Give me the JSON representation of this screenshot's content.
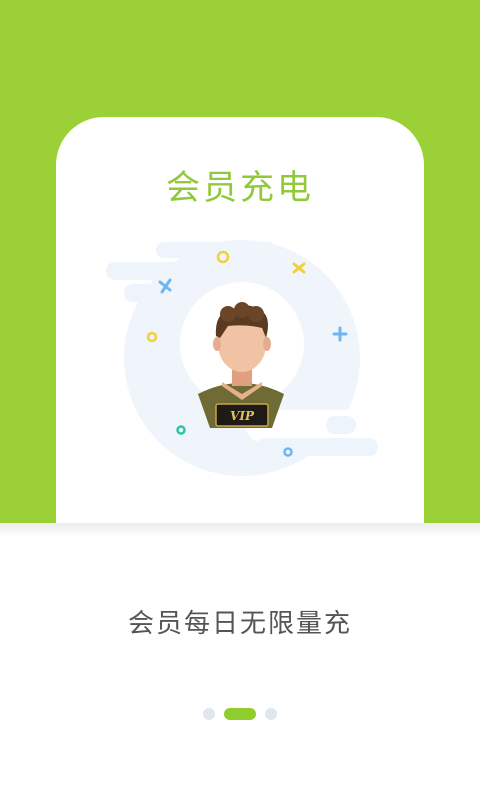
{
  "theme": {
    "brand_green": "#9bd136",
    "title_green": "#92c93a",
    "indicator_active": "#8fcd2f",
    "indicator_inactive": "#dfe6ee"
  },
  "card": {
    "title": "会员充电",
    "illustration": {
      "icon": "vip-member-avatar-icon",
      "badge_text": "VIP"
    }
  },
  "caption": "会员每日无限量充",
  "pager": {
    "total_pages": 3,
    "current_page": 2
  }
}
